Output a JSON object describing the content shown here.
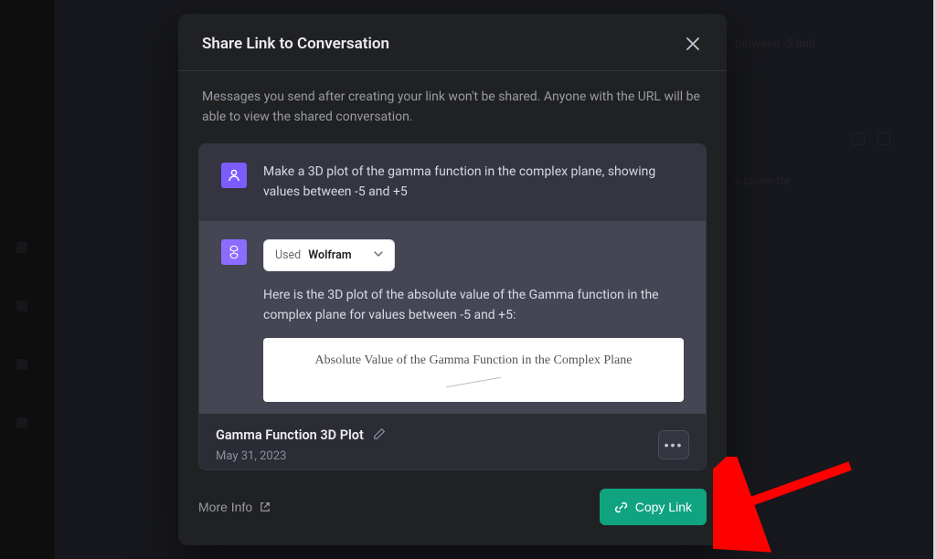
{
  "background": {
    "snippet_top": "between -5 and",
    "snippet_mid": "x plane for"
  },
  "modal": {
    "title": "Share Link to Conversation",
    "description": "Messages you send after creating your link won't be shared. Anyone with the URL will be able to view the shared conversation.",
    "footer": {
      "more_info_label": "More Info",
      "copy_button_label": "Copy Link"
    }
  },
  "preview": {
    "messages": [
      {
        "role": "user",
        "text": "Make a 3D plot of the gamma function in the complex plane, showing values between -5 and +5"
      },
      {
        "role": "assistant",
        "used_tool_prefix": "Used",
        "used_tool_name": "Wolfram",
        "text": "Here is the 3D plot of the absolute value of the Gamma function in the complex plane for values between -5 and +5:",
        "plot_title": "Absolute Value of the Gamma Function in the Complex Plane"
      }
    ],
    "conversation_title": "Gamma Function 3D Plot",
    "conversation_date": "May 31, 2023"
  }
}
